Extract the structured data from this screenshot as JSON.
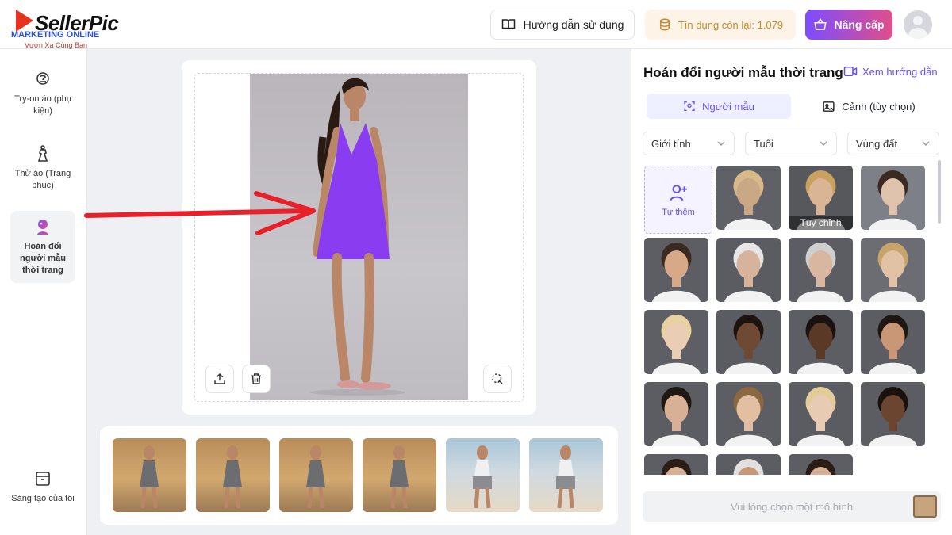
{
  "logo": {
    "brand": "SellerPic",
    "overlay": "MARKETING ONLINE",
    "tagline": "Vươn Xa Cùng Bạn"
  },
  "header": {
    "guide_label": "Hướng dẫn sử dụng",
    "credit_label": "Tín dụng còn lại: 1.079",
    "upgrade_label": "Nâng cấp",
    "colors": {
      "accent": "#6a4cf5",
      "credit": "#c98a2c"
    }
  },
  "sidebar": {
    "items": [
      {
        "label": "Try-on áo (phụ kiện)",
        "icon": "hanger-bag-icon"
      },
      {
        "label": "Thử áo (Trang phục)",
        "icon": "dress-icon"
      },
      {
        "label": "Hoán đổi người mẫu thời trang",
        "icon": "model-swap-icon"
      }
    ],
    "bottom_label": "Sáng tạo của tôi"
  },
  "panel": {
    "title": "Hoán đổi người mẫu thời trang",
    "help_link": "Xem hướng dẫn",
    "tabs": [
      {
        "label": "Người mẫu"
      },
      {
        "label": "Cảnh (tùy chọn)"
      }
    ],
    "filters": [
      {
        "label": "Giới tính"
      },
      {
        "label": "Tuổi"
      },
      {
        "label": "Vùng đất"
      }
    ],
    "add_label": "Tự thêm",
    "custom_label": "Tùy chỉnh",
    "submit_placeholder": "Vui lòng chọn một mô hình"
  },
  "models": [
    {
      "tone": "#caa886",
      "hair": "#d7b98a",
      "bg": "#5f6166"
    },
    {
      "tone": "#d9b596",
      "hair": "#c9a160",
      "bg": "#56585c"
    },
    {
      "tone": "#e0c3ad",
      "hair": "#3a2a22",
      "bg": "#7d8086"
    },
    {
      "tone": "#d7a988",
      "hair": "#3a2a20",
      "bg": "#5c5e63"
    },
    {
      "tone": "#d8b39b",
      "hair": "#e6e6e6",
      "bg": "#5a5c61"
    },
    {
      "tone": "#d8b6a0",
      "hair": "#cfcfcf",
      "bg": "#5b5d62"
    },
    {
      "tone": "#e2c2a5",
      "hair": "#c7a46a",
      "bg": "#6b6d72"
    },
    {
      "tone": "#e9cdb5",
      "hair": "#e8d3a0",
      "bg": "#5d5f64"
    },
    {
      "tone": "#6e4a33",
      "hair": "#1d1410",
      "bg": "#5a5c61"
    },
    {
      "tone": "#5a3a26",
      "hair": "#1a120e",
      "bg": "#5c5e63"
    },
    {
      "tone": "#c99676",
      "hair": "#1f1712",
      "bg": "#5b5d62"
    },
    {
      "tone": "#d8b095",
      "hair": "#1f1712",
      "bg": "#5b5d62"
    },
    {
      "tone": "#e2bfa2",
      "hair": "#8a6840",
      "bg": "#5c5e63"
    },
    {
      "tone": "#e8cbb3",
      "hair": "#e2cc98",
      "bg": "#5a5c61"
    },
    {
      "tone": "#6b4530",
      "hair": "#1a110d",
      "bg": "#5b5d62"
    },
    {
      "tone": "#d8b095",
      "hair": "#2a1d16",
      "bg": "#5c5e63"
    },
    {
      "tone": "#c99676",
      "hair": "#e0e0e0",
      "bg": "#5b5d62"
    },
    {
      "tone": "#d8b095",
      "hair": "#2a1d16",
      "bg": "#5c5e63"
    }
  ],
  "thumbnails": [
    {
      "scene": "street",
      "outfit": "#6b6d70"
    },
    {
      "scene": "street",
      "outfit": "#6b6d70"
    },
    {
      "scene": "street",
      "outfit": "#6b6d70"
    },
    {
      "scene": "street",
      "outfit": "#6b6d70"
    },
    {
      "scene": "beach",
      "outfit": "#f0f0f0"
    },
    {
      "scene": "beach",
      "outfit": "#f0f0f0"
    }
  ],
  "garment_color": "#8a3cf0"
}
